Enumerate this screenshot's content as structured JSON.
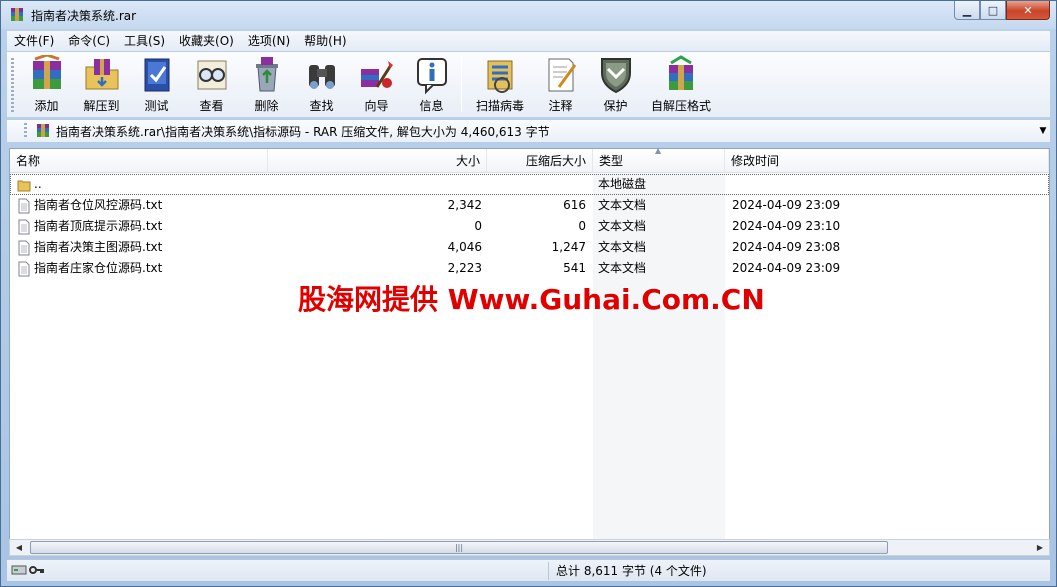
{
  "window": {
    "title": "指南者决策系统.rar"
  },
  "menu": [
    "文件(F)",
    "命令(C)",
    "工具(S)",
    "收藏夹(O)",
    "选项(N)",
    "帮助(H)"
  ],
  "toolbar": {
    "add": "添加",
    "extract": "解压到",
    "test": "测试",
    "view": "查看",
    "delete": "删除",
    "find": "查找",
    "wizard": "向导",
    "info": "信息",
    "scan": "扫描病毒",
    "comment": "注释",
    "protect": "保护",
    "sfx": "自解压格式"
  },
  "address": {
    "path": "指南者决策系统.rar\\指南者决策系统\\指标源码 - RAR 压缩文件, 解包大小为 4,460,613 字节"
  },
  "columns": {
    "name": "名称",
    "size": "大小",
    "packed": "压缩后大小",
    "type": "类型",
    "modified": "修改时间"
  },
  "rows": [
    {
      "name": "..",
      "size": "",
      "packed": "",
      "type": "本地磁盘",
      "modified": "",
      "icon": "folder-icon"
    },
    {
      "name": "指南者仓位风控源码.txt",
      "size": "2,342",
      "packed": "616",
      "type": "文本文档",
      "modified": "2024-04-09 23:09",
      "icon": "text-file-icon"
    },
    {
      "name": "指南者顶底提示源码.txt",
      "size": "0",
      "packed": "0",
      "type": "文本文档",
      "modified": "2024-04-09 23:10",
      "icon": "text-file-icon"
    },
    {
      "name": "指南者决策主图源码.txt",
      "size": "4,046",
      "packed": "1,247",
      "type": "文本文档",
      "modified": "2024-04-09 23:08",
      "icon": "text-file-icon"
    },
    {
      "name": "指南者庄家仓位源码.txt",
      "size": "2,223",
      "packed": "541",
      "type": "文本文档",
      "modified": "2024-04-09 23:09",
      "icon": "text-file-icon"
    }
  ],
  "watermark": "股海网提供 Www.Guhai.Com.CN",
  "status": {
    "summary": "总计 8,611 字节 (4 个文件)"
  },
  "colors": {
    "watermark": "#e00000",
    "window_frame": "#b9d1ea"
  }
}
